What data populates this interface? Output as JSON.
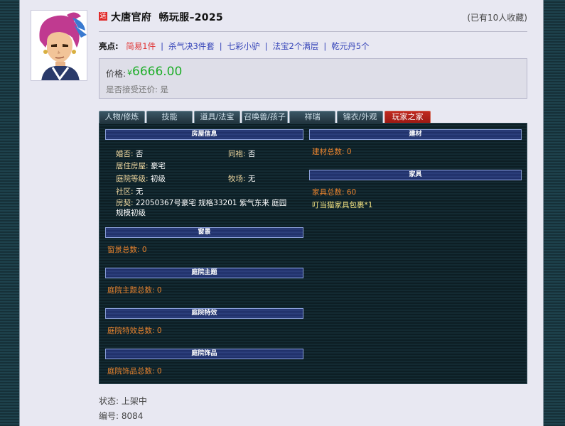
{
  "header": {
    "badge": "送",
    "title": "大唐官府  畅玩服–2025",
    "favorites": "(已有10人收藏)"
  },
  "highlights": {
    "label": "亮点:",
    "items": [
      "简易1件",
      "杀气决3件套",
      "七彩小驴",
      "法宝2个满层",
      "乾元丹5个"
    ]
  },
  "price": {
    "label": "价格:",
    "currency": "¥",
    "value": "6666.00",
    "counter_label": "是否接受还价:",
    "counter_value": "是"
  },
  "tabs": [
    "人物/修炼",
    "技能",
    "道具/法宝",
    "召唤兽/孩子",
    "祥瑞",
    "锦衣/外观",
    "玩家之家"
  ],
  "home": {
    "house_header": "房屋信息",
    "married_k": "婚否:",
    "married_v": "否",
    "paozi_k": "同袍:",
    "paozi_v": "否",
    "house_k": "居住房屋:",
    "house_v": "豪宅",
    "yard_k": "庭院等级:",
    "yard_v": "初级",
    "ranch_k": "牧场:",
    "ranch_v": "无",
    "community_k": "社区:",
    "community_v": "无",
    "deed_k": "房契:",
    "deed_v": "22050367号豪宅 规格33201 紫气东来 庭园规模初级",
    "window_header": "窗景",
    "window_total": "窗景总数: 0",
    "theme_header": "庭院主题",
    "theme_total": "庭院主题总数: 0",
    "effect_header": "庭院特效",
    "effect_total": "庭院特效总数: 0",
    "deco_header": "庭院饰品",
    "deco_total": "庭院饰品总数: 0",
    "material_header": "建材",
    "material_total": "建材总数: 0",
    "furniture_header": "家具",
    "furniture_total": "家具总数: 60",
    "furniture_item": "叮当猫家具包裹*1"
  },
  "footer": {
    "status": "状态:  上架中",
    "serial": "编号:  8084"
  },
  "colors": {
    "accent_red": "#e03030",
    "link_blue": "#3443b8",
    "price_green": "#1fae2a",
    "active_tab": "#c02a20"
  }
}
